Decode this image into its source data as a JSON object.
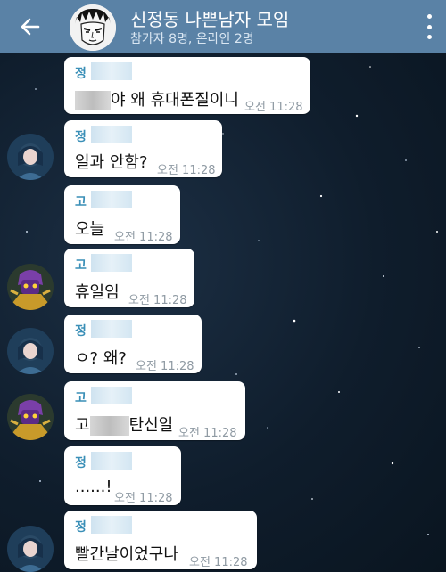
{
  "header": {
    "title": "신정동 나쁜남자 모임",
    "subtitle": "참가자 8명, 온라인 2명",
    "color": "#5a82a6"
  },
  "icons": {
    "back": "back-arrow-icon",
    "menu": "more-vert-icon"
  },
  "messages": [
    {
      "sender": "정",
      "text_suffix": "야 왜 휴대폰질이니",
      "time": "오전 11:28"
    },
    {
      "sender": "정",
      "text": "일과 안함?",
      "time": "오전 11:28"
    },
    {
      "sender": "고",
      "text": "오늘",
      "time": "오전 11:28"
    },
    {
      "sender": "고",
      "text": "휴일임",
      "time": "오전 11:28"
    },
    {
      "sender": "정",
      "text": "ㅇ? 왜?",
      "time": "오전 11:28"
    },
    {
      "sender": "고",
      "text_prefix": "고",
      "text_suffix": "탄신일",
      "time": "오전 11:28"
    },
    {
      "sender": "정",
      "text": "......!",
      "time": "오전 11:28"
    },
    {
      "sender": "정",
      "text": "빨간날이었구나",
      "time": "오전 11:28"
    }
  ]
}
